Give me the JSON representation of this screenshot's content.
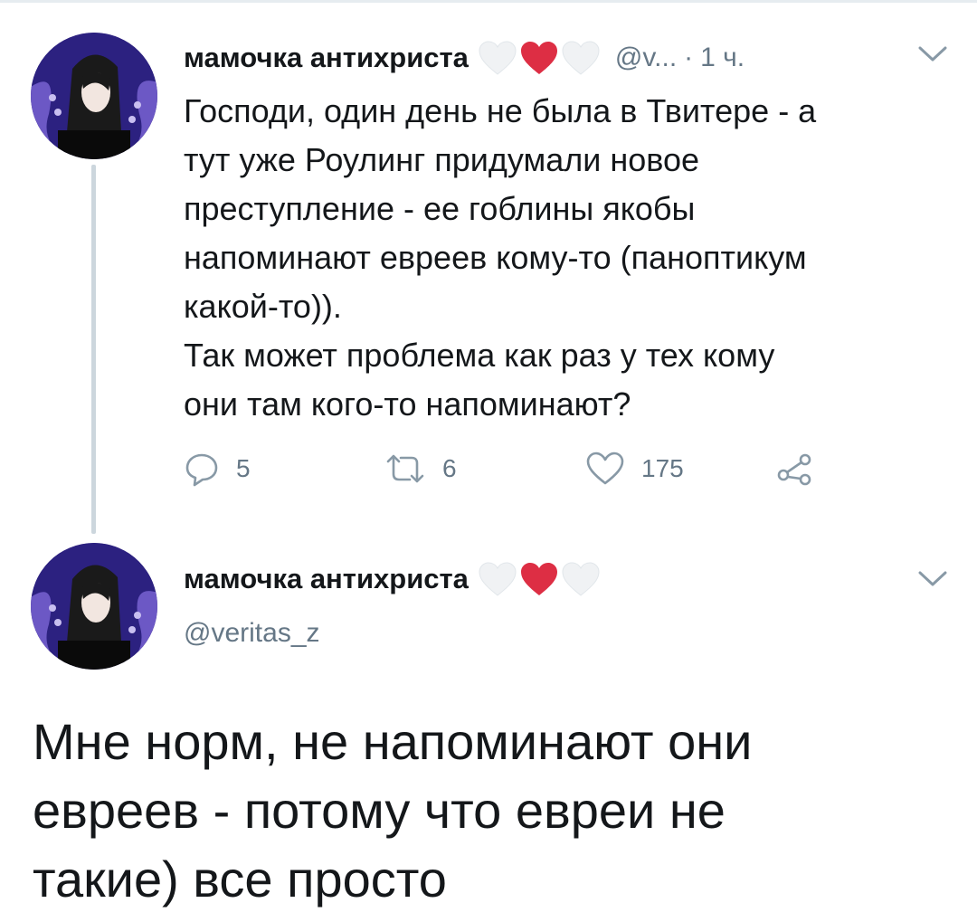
{
  "tweet": {
    "author_name": "мамочка антихриста",
    "handle_short": "@v...",
    "dot": "·",
    "time": "1 ч.",
    "text_lines": [
      "Господи, один день не была в Твитере - а",
      "тут уже Роулинг придумали новое",
      "преступление - ее гоблины якобы",
      "напоминают евреев кому-то (паноптикум",
      "какой-то)).",
      "Так может проблема как раз у тех кому",
      "они там кого-то напоминают?"
    ],
    "actions": {
      "reply_count": "5",
      "retweet_count": "6",
      "like_count": "175"
    }
  },
  "reply": {
    "author_name": "мамочка антихриста",
    "handle": "@veritas_z",
    "text_lines": [
      "Мне норм, не напоминают они",
      "евреев - потому что евреи не",
      "такие) все просто"
    ]
  },
  "icons": {
    "hearts": [
      "white-heart-icon",
      "red-heart-icon",
      "white-heart-icon"
    ],
    "reply": "reply-icon",
    "retweet": "retweet-icon",
    "like": "like-icon",
    "share": "share-icon",
    "menu": "chevron-down-icon"
  },
  "colors": {
    "text_primary": "#14171a",
    "text_secondary": "#657786",
    "thread_line": "#ccd6dd",
    "heart_red": "#dd2e44",
    "heart_white": "#f0f2f4",
    "avatar_bg": "#3a2a8f"
  }
}
